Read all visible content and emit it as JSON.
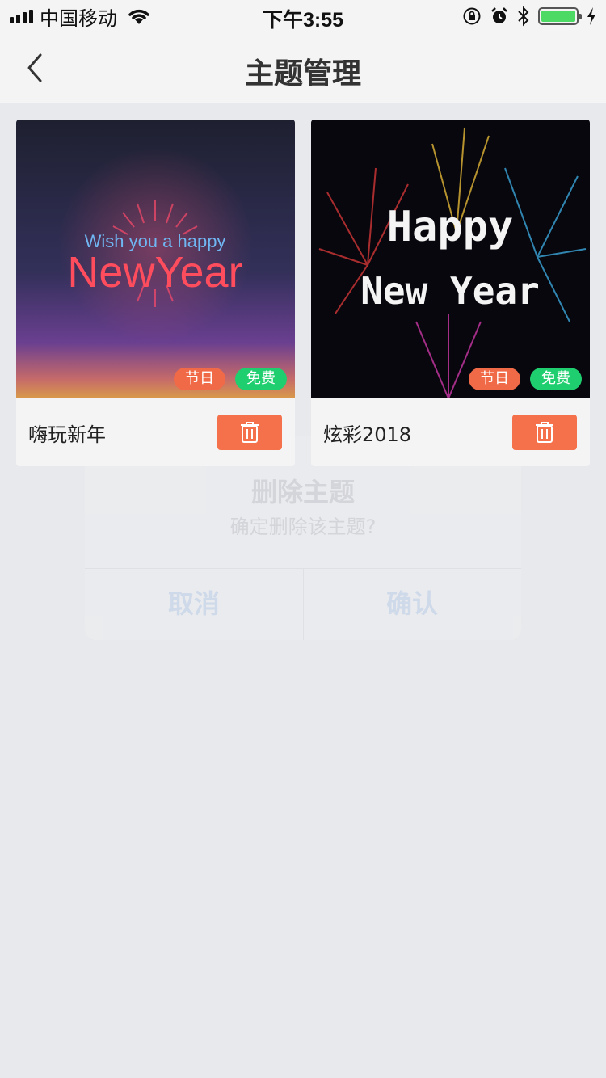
{
  "status_bar": {
    "carrier": "中国移动",
    "time": "下午3:55"
  },
  "nav": {
    "title": "主题管理"
  },
  "themes": [
    {
      "name": "嗨玩新年",
      "image_text_line1": "Wish you a happy",
      "image_text_line2": "NewYear",
      "tag_holiday": "节日",
      "tag_free": "免费"
    },
    {
      "name": "炫彩2018",
      "image_text_line1": "Happy",
      "image_text_line2": "New Year",
      "tag_holiday": "节日",
      "tag_free": "免费"
    }
  ],
  "dialog": {
    "title": "删除主题",
    "message": "确定删除该主题?",
    "cancel_label": "取消",
    "confirm_label": "确认"
  },
  "colors": {
    "accent_orange": "#f4714b",
    "free_green": "#1fcf6f",
    "battery_green": "#4cd964"
  }
}
